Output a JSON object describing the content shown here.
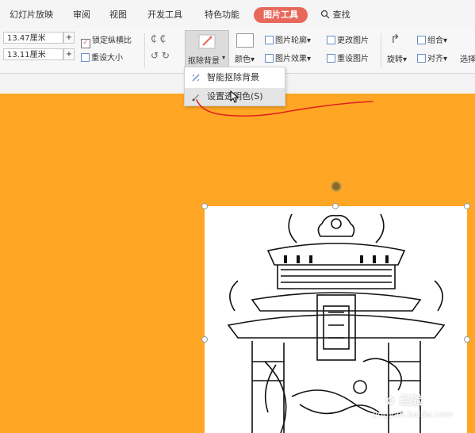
{
  "tabs": [
    "幻灯片放映",
    "审阅",
    "视图",
    "开发工具",
    "特色功能",
    "图片工具"
  ],
  "active_tab": "图片工具",
  "search_label": "查找",
  "size": {
    "width": "13.47厘米",
    "height": "13.11厘米",
    "lock_ratio": "锁定纵横比",
    "reset_size": "重设大小"
  },
  "ribbon": {
    "remove_bg": "抠除背景",
    "color": "颜色",
    "outline": "图片轮廓",
    "effects": "图片效果",
    "change_pic": "更改图片",
    "reset_pic": "重设图片",
    "rotate": "旋转",
    "group": "组合",
    "align": "对齐",
    "select": "选择"
  },
  "menu": {
    "item1": "智能抠除背景",
    "item2": "设置透明色(S)"
  },
  "watermark": {
    "line1": "经验",
    "line2": "jingyan.baidu.com"
  },
  "colors": {
    "accent": "#e8685b",
    "slide_bg": "#ffa724",
    "annotation": "#e02020"
  }
}
